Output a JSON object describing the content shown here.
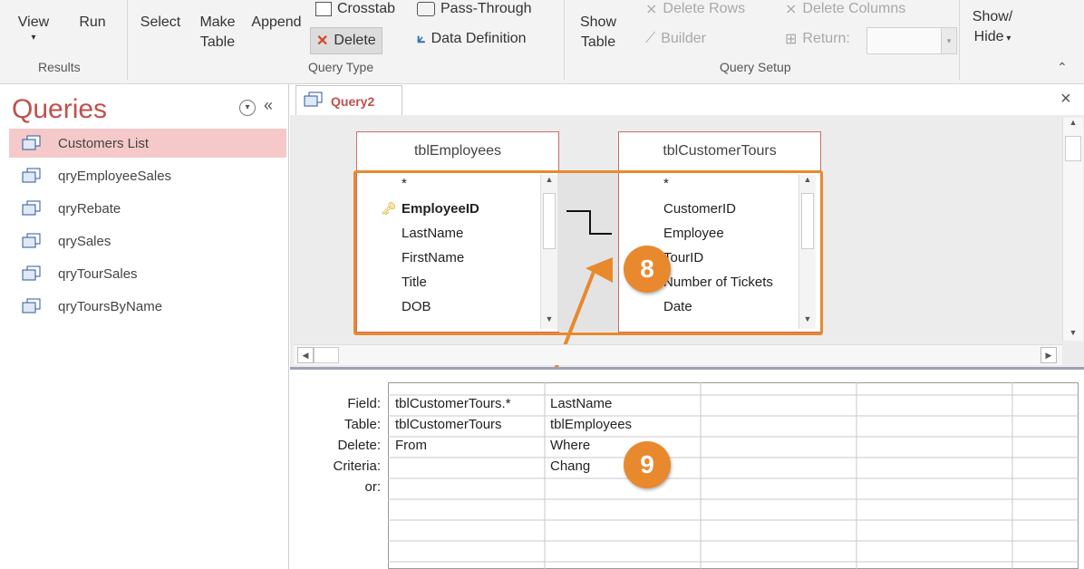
{
  "ribbon": {
    "results": {
      "label": "Results",
      "view": "View",
      "run": "Run"
    },
    "query_type": {
      "label": "Query Type",
      "select": "Select",
      "make_table_1": "Make",
      "make_table_2": "Table",
      "append": "Append",
      "crosstab": "Crosstab",
      "pass_through": "Pass-Through",
      "delete": "Delete",
      "data_definition": "Data Definition"
    },
    "query_setup": {
      "label": "Query Setup",
      "show_table_1": "Show",
      "show_table_2": "Table",
      "delete_rows": "Delete Rows",
      "delete_columns": "Delete Columns",
      "builder": "Builder",
      "return": "Return:",
      "show_hide_1": "Show/",
      "show_hide_2": "Hide"
    }
  },
  "nav": {
    "title": "Queries",
    "items": [
      {
        "label": "Customers List",
        "selected": true
      },
      {
        "label": "qryEmployeeSales"
      },
      {
        "label": "qryRebate"
      },
      {
        "label": "qrySales"
      },
      {
        "label": "qryTourSales"
      },
      {
        "label": "qryToursByName"
      }
    ]
  },
  "tab": {
    "label": "Query2",
    "close": "×"
  },
  "tables": {
    "employees": {
      "title": "tblEmployees",
      "fields": [
        "*",
        "EmployeeID",
        "LastName",
        "FirstName",
        "Title",
        "DOB"
      ]
    },
    "customer_tours": {
      "title": "tblCustomerTours",
      "fields": [
        "*",
        "CustomerID",
        "Employee",
        "TourID",
        "Number of Tickets",
        "Date"
      ]
    }
  },
  "callouts": {
    "c8": "8",
    "c9": "9"
  },
  "grid": {
    "row_labels": [
      "Field:",
      "Table:",
      "Delete:",
      "Criteria:",
      "or:"
    ],
    "columns": [
      {
        "field": "tblCustomerTours.*",
        "table": "tblCustomerTours",
        "delete": "From",
        "criteria": ""
      },
      {
        "field": "LastName",
        "table": "tblEmployees",
        "delete": "Where",
        "criteria": "Chang"
      }
    ]
  },
  "colors": {
    "accent": "#e8892e",
    "nav_title": "#c0504d",
    "selected": "#f5c9c9"
  }
}
